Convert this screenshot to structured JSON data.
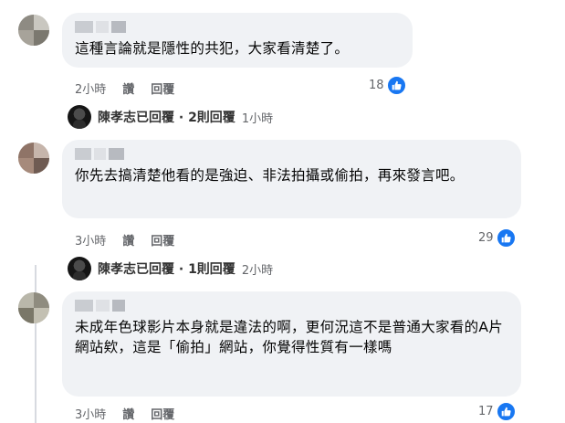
{
  "comments": [
    {
      "text": "這種言論就是隱性的共犯，大家看清楚了。",
      "time": "2小時",
      "like_label": "讚",
      "reply_label": "回覆",
      "like_count": "18",
      "reply_summary": {
        "link": "陳孝志已回覆 · 2則回覆",
        "time": "1小時"
      }
    },
    {
      "text": "你先去搞清楚他看的是強迫、非法拍攝或偷拍，再來發言吧。",
      "time": "3小時",
      "like_label": "讚",
      "reply_label": "回覆",
      "like_count": "29",
      "reply_summary": {
        "link": "陳孝志已回覆 · 1則回覆",
        "time": "2小時"
      }
    },
    {
      "text": "未成年色球影片本身就是違法的啊，更何況這不是普通大家看的A片網站欸，這是「偷拍」網站，你覺得性質有一樣嗎",
      "time": "3小時",
      "like_label": "讚",
      "reply_label": "回覆",
      "like_count": "17"
    }
  ],
  "colors": {
    "bubble": "#f0f2f5",
    "meta_text": "#65676b",
    "like_blue": "#1877f2"
  },
  "icons": {
    "like": "thumbs-up-icon"
  }
}
